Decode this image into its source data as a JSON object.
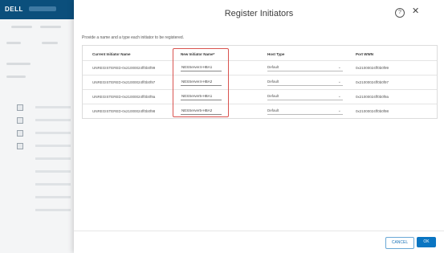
{
  "app": {
    "logo": "DELL"
  },
  "dialog": {
    "title": "Register Initiators",
    "description": "Provide a name and a type each initiator to be registered.",
    "columns": [
      "Current Initiator Name",
      "New Initiator Name*",
      "Host Type",
      "Port WWN"
    ],
    "rows": [
      {
        "current": "UNREGISTERED-0x21000024ff0b0f99",
        "new": "NESServer4-HBA1",
        "host_type": "Default",
        "wwn": "0x21000024ff0b0f99"
      },
      {
        "current": "UNREGISTERED-0x21000024ff0b0f97",
        "new": "NESServer4-HBA2",
        "host_type": "Default",
        "wwn": "0x21000024ff0b0f97"
      },
      {
        "current": "UNREGISTERED-0x21000024ff0b0f9a",
        "new": "NESServer5-HBA1",
        "host_type": "Default",
        "wwn": "0x21000024ff0b0f9a"
      },
      {
        "current": "UNREGISTERED-0x21000024ff0b0f98",
        "new": "NESServer5-HBA2",
        "host_type": "Default",
        "wwn": "0x21000024ff0b0f98"
      }
    ],
    "buttons": {
      "cancel": "CANCEL",
      "ok": "OK"
    },
    "icons": {
      "help": "?",
      "close": "✕",
      "chevron": "⌄"
    }
  },
  "colors": {
    "accent": "#0a75c2",
    "highlight": "#d9534f",
    "topbar": "#0b4f7c"
  }
}
